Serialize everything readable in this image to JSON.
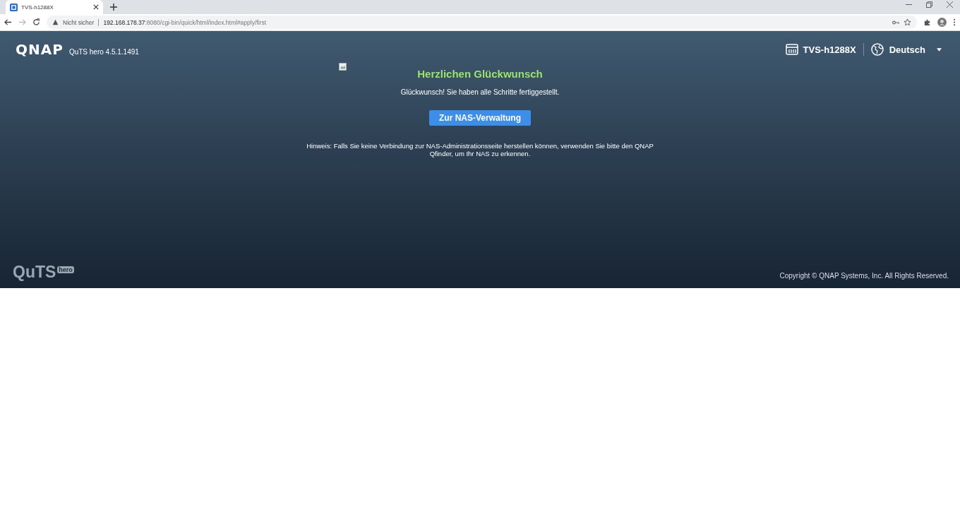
{
  "browser": {
    "tabs": [
      {
        "title": "TVS-h1288X",
        "selected": true
      }
    ],
    "security": "Nicht sicher",
    "url_host": "192.168.178.37",
    "url_rest": ":8080/cgi-bin/quick/html/index.html#apply/first"
  },
  "header": {
    "logo": "QNAP",
    "version": "QuTS hero 4.5.1.1491",
    "device": "TVS-h1288X",
    "language": "Deutsch"
  },
  "content": {
    "title": "Herzlichen Glückwunsch",
    "message": "Glückwunsch! Sie haben alle Schritte fertiggestellt.",
    "button": "Zur NAS-Verwaltung",
    "hint": "Hinweis: Falls Sie keine Verbindung zur NAS-Administrationsseite herstellen können, verwenden Sie bitte den QNAP Qfinder, um Ihr NAS zu erkennen."
  },
  "footer": {
    "brand": "QuTS",
    "brand_badge": "hero",
    "copyright": "Copyright © QNAP Systems, Inc. All Rights Reserved."
  }
}
